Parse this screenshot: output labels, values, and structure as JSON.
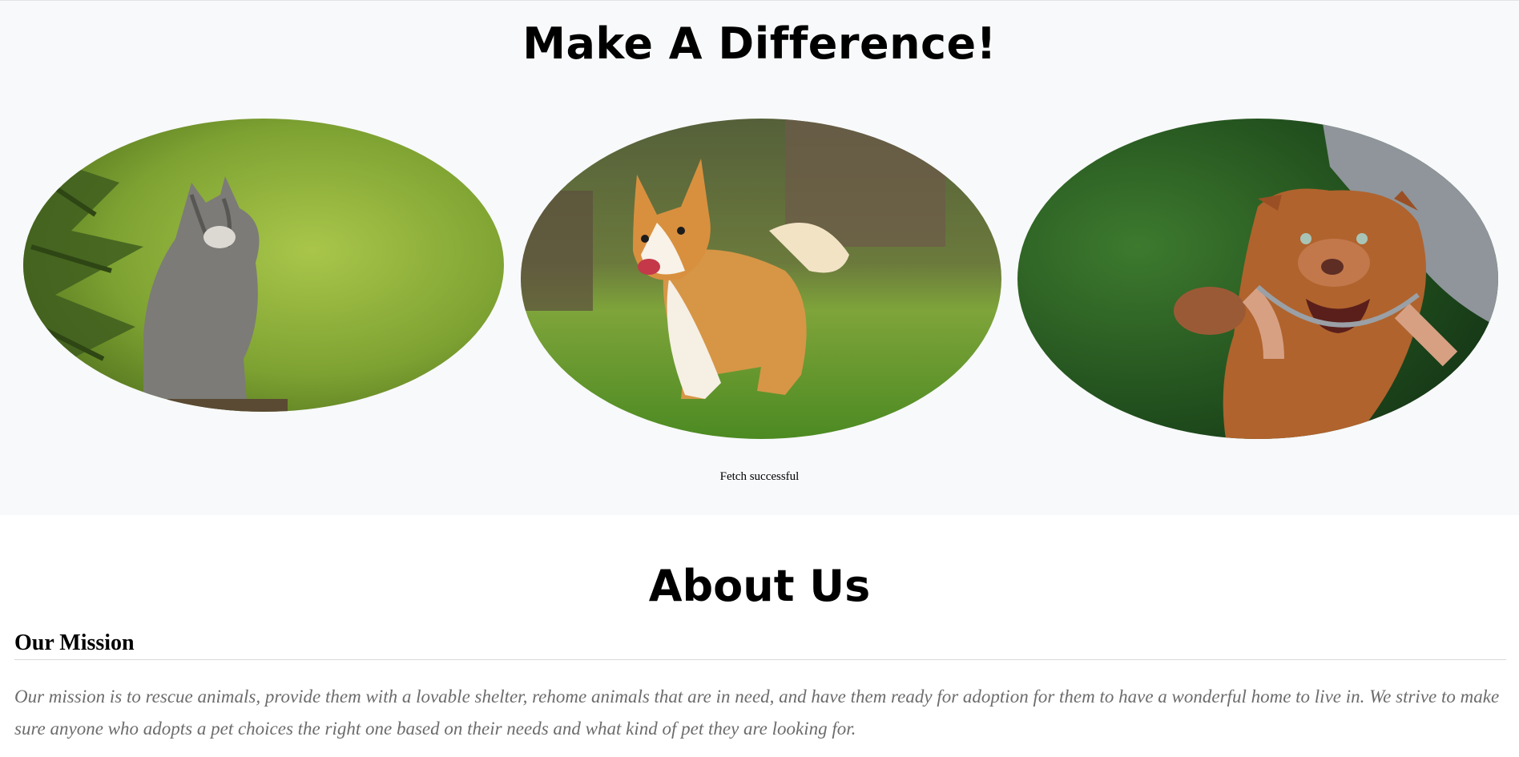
{
  "hero": {
    "title": "Make A Difference!",
    "pets": [
      {
        "subject": "gray kitten",
        "icon": "cat-photo"
      },
      {
        "subject": "corgi running on grass",
        "icon": "corgi-photo"
      },
      {
        "subject": "brown pit bull with raised paw",
        "icon": "pitbull-photo"
      }
    ],
    "status": "Fetch successful",
    "background": "#f8f9fa"
  },
  "about": {
    "title": "About Us",
    "mission_heading": "Our Mission",
    "mission_text": "Our mission is to rescue animals, provide them with a lovable shelter, rehome animals that are in need, and have them ready for adoption for them to have a wonderful home to live in. We strive to make sure anyone who adopts a pet choices the right one based on their needs and what kind of pet they are looking for."
  }
}
